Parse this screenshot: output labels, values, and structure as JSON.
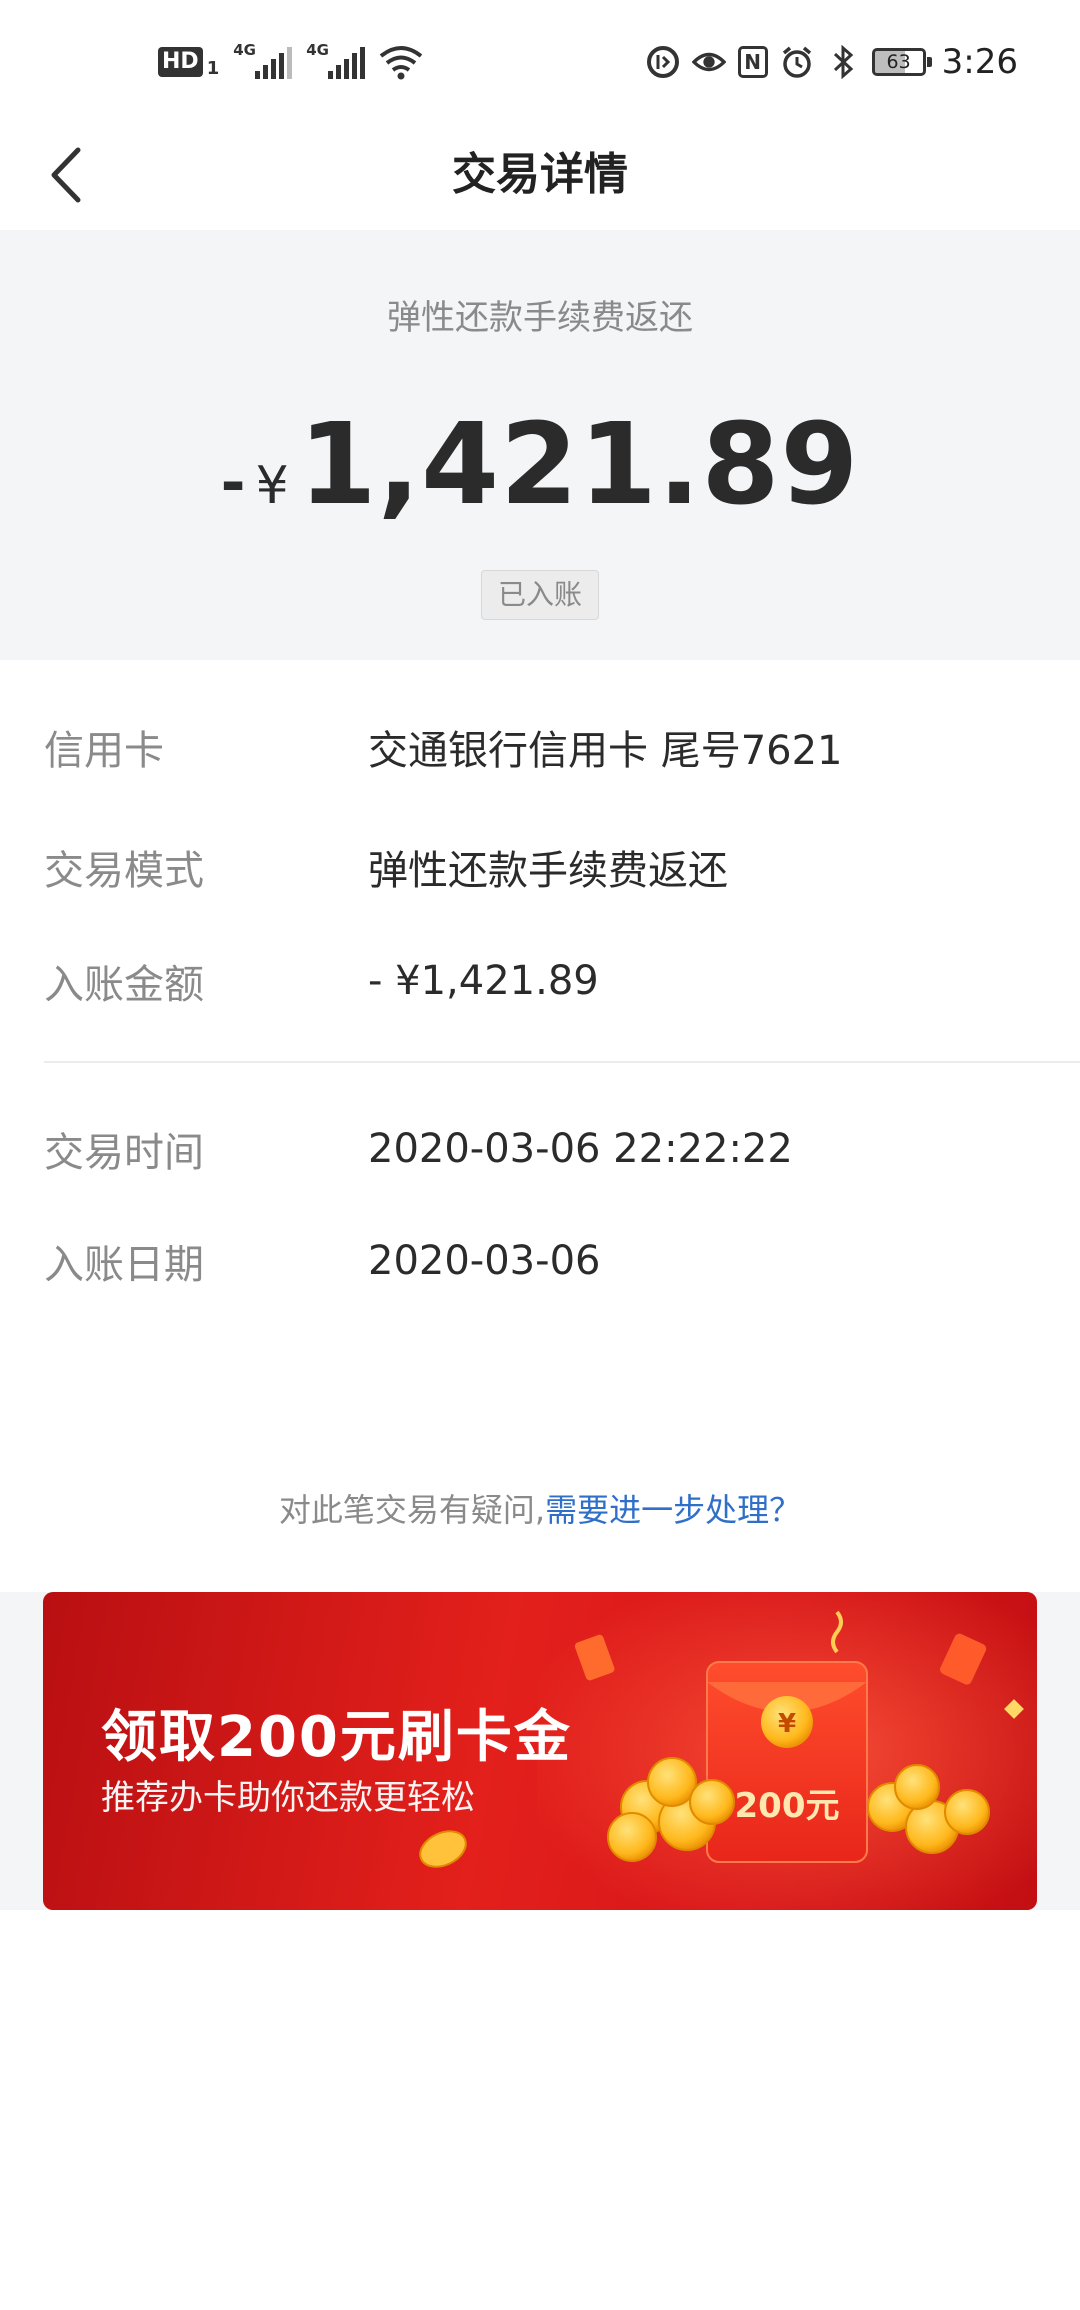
{
  "status_bar": {
    "hd": "HD",
    "hd_sub": "1",
    "sim1": "4G",
    "sim2": "4G",
    "battery": "63",
    "time": "3:26"
  },
  "header": {
    "title": "交易详情"
  },
  "summary": {
    "label": "弹性还款手续费返还",
    "sign": "-",
    "currency": "¥",
    "amount": "1,421.89",
    "status_badge": "已入账"
  },
  "details": {
    "card_key": "信用卡",
    "card_value": "交通银行信用卡 尾号7621",
    "mode_key": "交易模式",
    "mode_value": "弹性还款手续费返还",
    "posted_amount_key": "入账金额",
    "posted_amount_value": "- ¥1,421.89",
    "time_key": "交易时间",
    "time_value": "2020-03-06 22:22:22",
    "date_key": "入账日期",
    "date_value": "2020-03-06"
  },
  "help": {
    "text": "对此笔交易有疑问,",
    "link": "需要进一步处理？"
  },
  "banner": {
    "title": "领取200元刷卡金",
    "subtitle": "推荐办卡助你还款更轻松",
    "envelope_amount": "200元",
    "coin_symbol": "¥"
  },
  "colors": {
    "link": "#2f6fc9",
    "banner_red": "#e3201b",
    "summary_bg": "#f4f5f7"
  }
}
